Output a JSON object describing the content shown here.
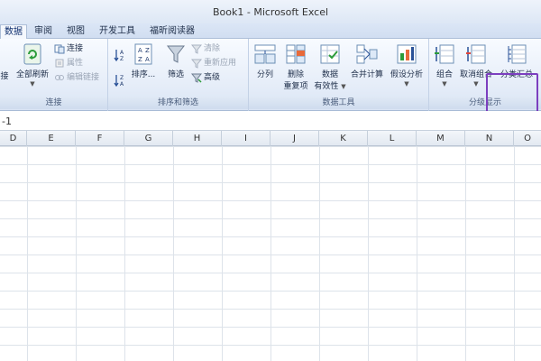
{
  "window": {
    "title": "Book1 - Microsoft Excel"
  },
  "tabs": [
    {
      "label": "数据",
      "active": true
    },
    {
      "label": "审阅",
      "active": false
    },
    {
      "label": "视图",
      "active": false
    },
    {
      "label": "开发工具",
      "active": false
    },
    {
      "label": "福昕阅读器",
      "active": false
    }
  ],
  "ribbon": {
    "groups": {
      "connections": {
        "label": "连接",
        "partial_left": "接",
        "refresh_all": "全部刷新",
        "connections": "连接",
        "properties": "属性",
        "edit_links": "编辑链接"
      },
      "sort_filter": {
        "label": "排序和筛选",
        "sort": "排序...",
        "filter": "筛选",
        "clear": "清除",
        "reapply": "重新应用",
        "advanced": "高级"
      },
      "data_tools": {
        "label": "数据工具",
        "text_to_columns": "分列",
        "remove_dup_1": "删除",
        "remove_dup_2": "重复项",
        "validation_1": "数据",
        "validation_2": "有效性",
        "consolidate": "合并计算",
        "what_if": "假设分析"
      },
      "outline": {
        "label": "分级显示",
        "group": "组合",
        "ungroup": "取消组合",
        "subtotal": "分类汇总"
      }
    }
  },
  "formula_bar": {
    "name_box": "-1"
  },
  "columns": [
    "D",
    "E",
    "F",
    "G",
    "H",
    "I",
    "J",
    "K",
    "L",
    "M",
    "N",
    "O"
  ],
  "colors": {
    "highlight": "#7c3fbf",
    "accent": "#1f5fbf"
  }
}
